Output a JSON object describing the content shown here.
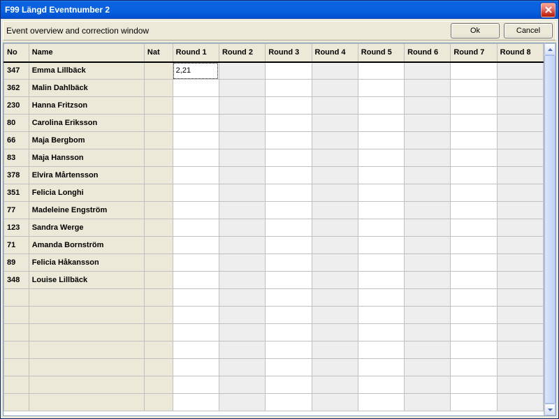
{
  "window": {
    "title": "F99 Längd Eventnumber 2"
  },
  "toolbar": {
    "description": "Event overview and correction window",
    "ok_label": "Ok",
    "cancel_label": "Cancel"
  },
  "table": {
    "headers": {
      "no": "No",
      "name": "Name",
      "nat": "Nat",
      "round1": "Round 1",
      "round2": "Round 2",
      "round3": "Round 3",
      "round4": "Round 4",
      "round5": "Round 5",
      "round6": "Round 6",
      "round7": "Round 7",
      "round8": "Round 8"
    },
    "rows": [
      {
        "no": "347",
        "name": "Emma Lillbäck",
        "nat": "",
        "r1": "2,21",
        "r2": "",
        "r3": "",
        "r4": "",
        "r5": "",
        "r6": "",
        "r7": "",
        "r8": ""
      },
      {
        "no": "362",
        "name": "Malin Dahlbäck",
        "nat": "",
        "r1": "",
        "r2": "",
        "r3": "",
        "r4": "",
        "r5": "",
        "r6": "",
        "r7": "",
        "r8": ""
      },
      {
        "no": "230",
        "name": "Hanna Fritzson",
        "nat": "",
        "r1": "",
        "r2": "",
        "r3": "",
        "r4": "",
        "r5": "",
        "r6": "",
        "r7": "",
        "r8": ""
      },
      {
        "no": "80",
        "name": "Carolina Eriksson",
        "nat": "",
        "r1": "",
        "r2": "",
        "r3": "",
        "r4": "",
        "r5": "",
        "r6": "",
        "r7": "",
        "r8": ""
      },
      {
        "no": "66",
        "name": "Maja Bergbom",
        "nat": "",
        "r1": "",
        "r2": "",
        "r3": "",
        "r4": "",
        "r5": "",
        "r6": "",
        "r7": "",
        "r8": ""
      },
      {
        "no": "83",
        "name": "Maja Hansson",
        "nat": "",
        "r1": "",
        "r2": "",
        "r3": "",
        "r4": "",
        "r5": "",
        "r6": "",
        "r7": "",
        "r8": ""
      },
      {
        "no": "378",
        "name": "Elvira  Mårtensson",
        "nat": "",
        "r1": "",
        "r2": "",
        "r3": "",
        "r4": "",
        "r5": "",
        "r6": "",
        "r7": "",
        "r8": ""
      },
      {
        "no": "351",
        "name": "Felicia Longhi",
        "nat": "",
        "r1": "",
        "r2": "",
        "r3": "",
        "r4": "",
        "r5": "",
        "r6": "",
        "r7": "",
        "r8": ""
      },
      {
        "no": "77",
        "name": "Madeleine Engström",
        "nat": "",
        "r1": "",
        "r2": "",
        "r3": "",
        "r4": "",
        "r5": "",
        "r6": "",
        "r7": "",
        "r8": ""
      },
      {
        "no": "123",
        "name": "Sandra Werge",
        "nat": "",
        "r1": "",
        "r2": "",
        "r3": "",
        "r4": "",
        "r5": "",
        "r6": "",
        "r7": "",
        "r8": ""
      },
      {
        "no": "71",
        "name": "Amanda Bornström",
        "nat": "",
        "r1": "",
        "r2": "",
        "r3": "",
        "r4": "",
        "r5": "",
        "r6": "",
        "r7": "",
        "r8": ""
      },
      {
        "no": "89",
        "name": "Felicia Håkansson",
        "nat": "",
        "r1": "",
        "r2": "",
        "r3": "",
        "r4": "",
        "r5": "",
        "r6": "",
        "r7": "",
        "r8": ""
      },
      {
        "no": "348",
        "name": "Louise Lillbäck",
        "nat": "",
        "r1": "",
        "r2": "",
        "r3": "",
        "r4": "",
        "r5": "",
        "r6": "",
        "r7": "",
        "r8": ""
      }
    ],
    "empty_row_count": 7,
    "selected_cell": {
      "row": 0,
      "col": "r1"
    }
  }
}
